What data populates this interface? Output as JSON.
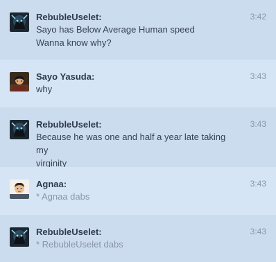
{
  "messages": [
    {
      "author": "RebubleUselet:",
      "time": "3:42",
      "lines": [
        "Sayo has Below Average Human speed",
        "Wanna know why?"
      ],
      "avatar_icon": "dark-creature-avatar-icon"
    },
    {
      "author": "Sayo Yasuda:",
      "time": "3:43",
      "lines": [
        "why"
      ],
      "avatar_icon": "anime-character-avatar-icon"
    },
    {
      "author": "RebubleUselet:",
      "time": "3:43",
      "lines": [
        "Because he was one and half a year late taking my",
        "virginity"
      ],
      "avatar_icon": "dark-creature-avatar-icon"
    },
    {
      "author": "Agnaa:",
      "time": "3:43",
      "lines": [
        "* Agnaa dabs"
      ],
      "avatar_icon": "person-avatar-icon"
    },
    {
      "author": "RebubleUselet:",
      "time": "3:43",
      "lines": [
        "* RebubleUselet dabs"
      ],
      "avatar_icon": "dark-creature-avatar-icon"
    }
  ],
  "colors": {
    "row_a": "#cbdcef",
    "row_b": "#d6e5f6",
    "author": "#2d3a4a",
    "text": "#364252",
    "action_text": "#8b95a3",
    "time": "#8a96a6"
  }
}
